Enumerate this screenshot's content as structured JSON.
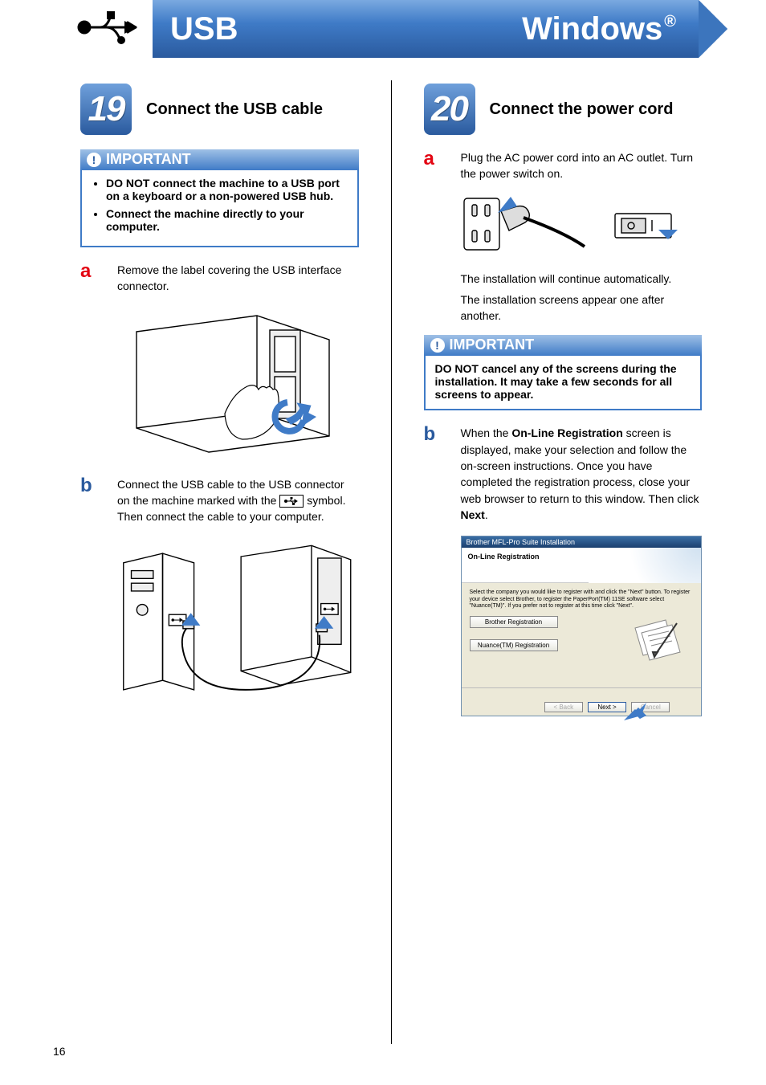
{
  "header": {
    "left_label": "USB",
    "right_label": "Windows",
    "right_suffix": "®"
  },
  "page_number": "16",
  "left": {
    "step_number": "19",
    "step_title": "Connect the USB cable",
    "important": {
      "heading": "IMPORTANT",
      "items": [
        "DO NOT connect the machine to a USB port on a keyboard or a non-powered USB hub.",
        "Connect the machine directly to your computer."
      ]
    },
    "a": {
      "letter": "a",
      "text": "Remove the label covering the USB interface connector."
    },
    "b": {
      "letter": "b",
      "text_pre": "Connect the USB cable to the USB connector on the machine marked with the ",
      "text_post": " symbol. Then connect the cable to your computer."
    }
  },
  "right": {
    "step_number": "20",
    "step_title": "Connect the power cord",
    "a": {
      "letter": "a",
      "text": "Plug the AC power cord into an AC outlet. Turn the power switch on.",
      "note1": "The installation will continue automatically.",
      "note2": "The installation screens appear one after another."
    },
    "important": {
      "heading": "IMPORTANT",
      "text": "DO NOT cancel any of the screens during the installation. It may take a few seconds for all screens to appear."
    },
    "b": {
      "letter": "b",
      "text_pre": "When the ",
      "bold1": "On-Line Registration",
      "text_mid": " screen is displayed, make your selection and follow the on-screen instructions. Once you have completed the registration process, close your web browser to return to this window. Then click ",
      "bold2": "Next",
      "text_post": "."
    },
    "dialog": {
      "title": "Brother MFL-Pro Suite Installation",
      "subtitle": "On-Line Registration",
      "body_text": "Select the company you would like to register with and click the \"Next\" button. To register your device select Brother, to register the PaperPort(TM) 11SE software select \"Nuance(TM)\". If you prefer not to register at this time click \"Next\".",
      "btn1": "Brother Registration",
      "btn2": "Nuance(TM) Registration",
      "back": "< Back",
      "next": "Next >",
      "cancel": "Cancel"
    }
  }
}
